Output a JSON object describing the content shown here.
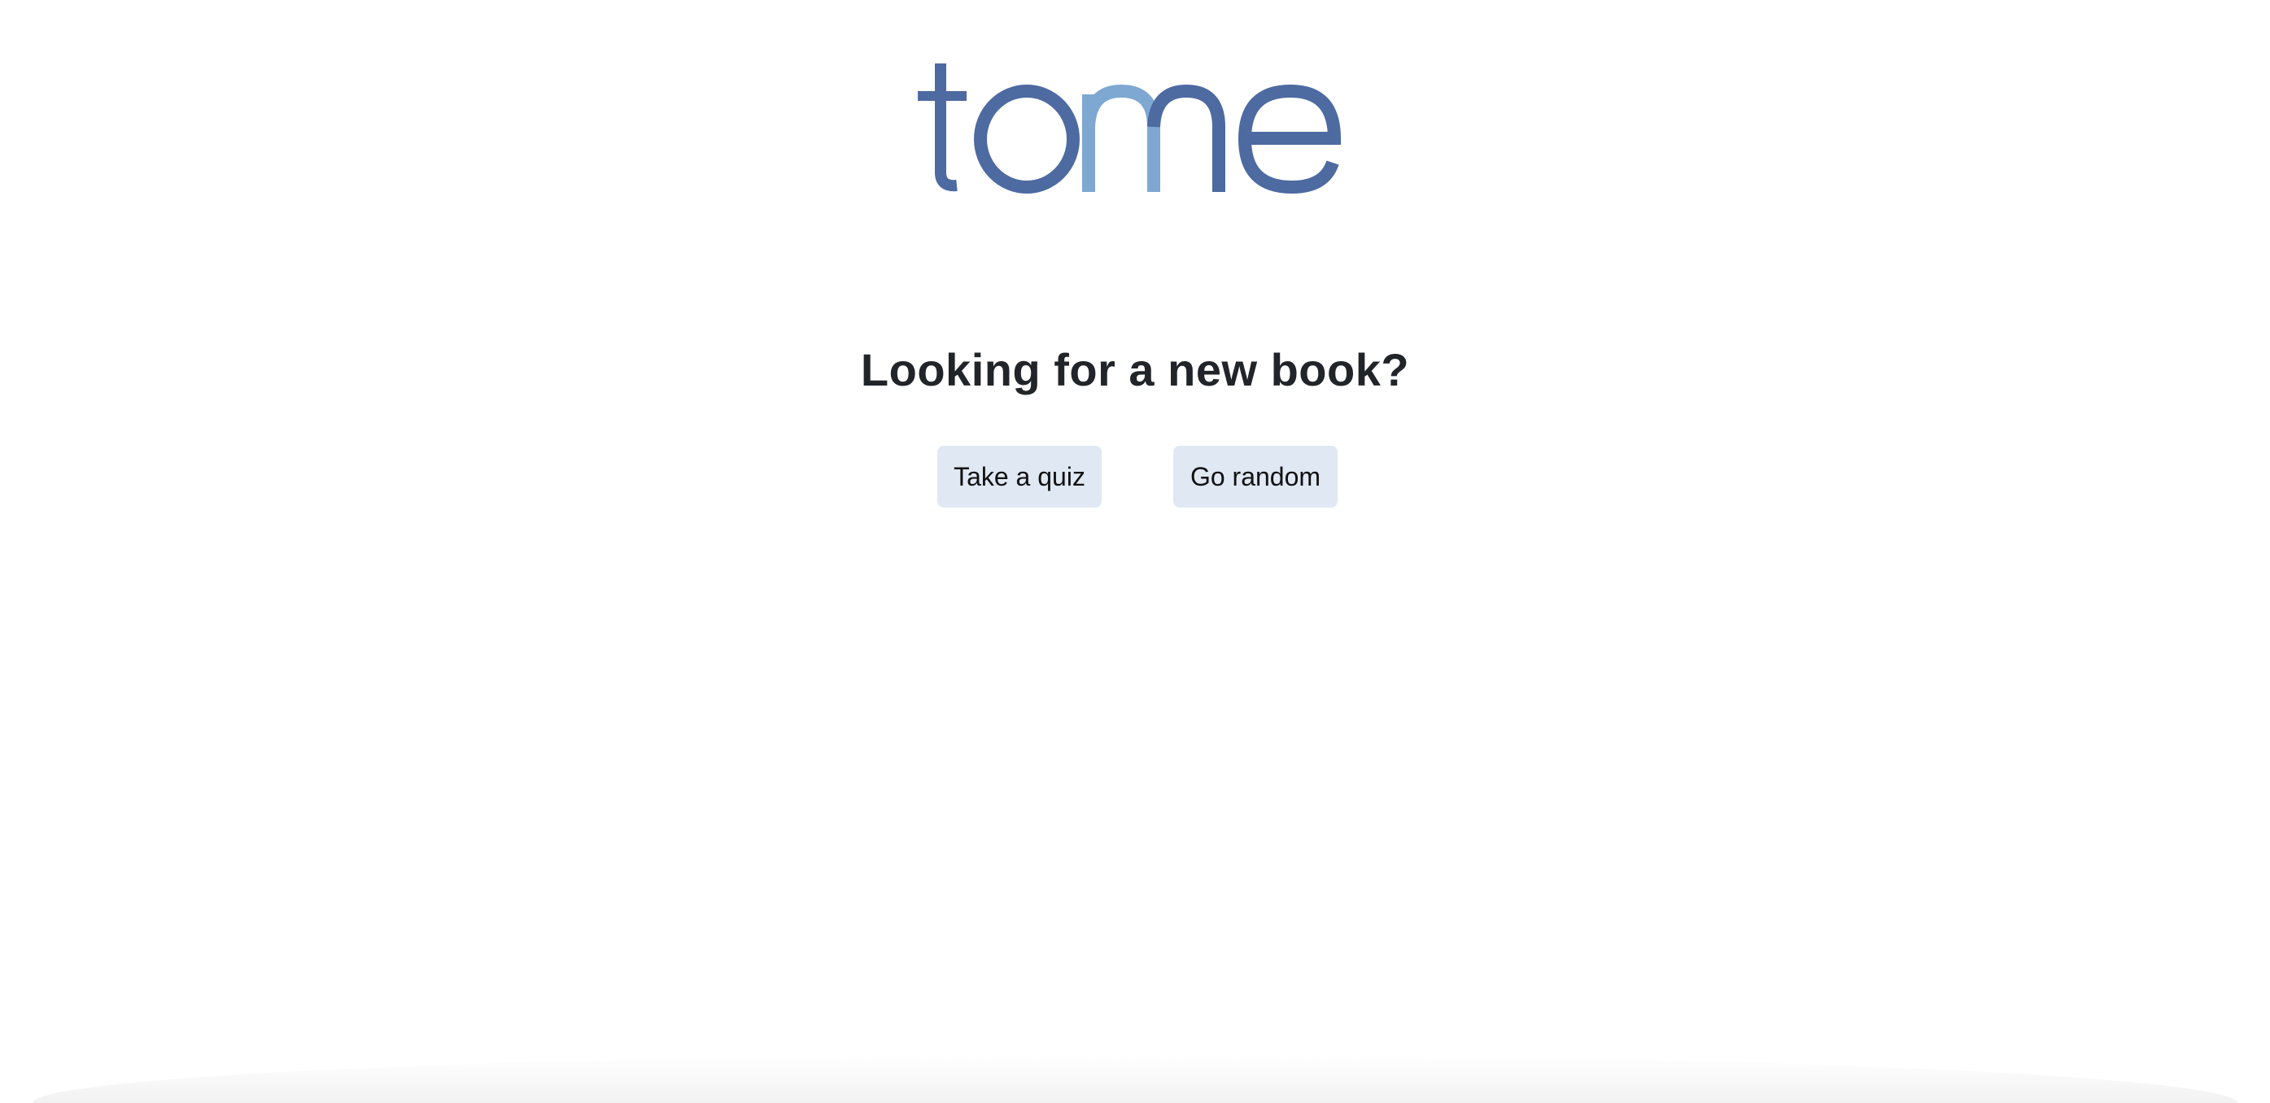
{
  "brand": {
    "logo_text": "tome",
    "letters": [
      "t",
      "o",
      "m",
      "e"
    ],
    "primary_color": "#4d6aa1",
    "accent_color": "#7ea8d1"
  },
  "hero": {
    "headline": "Looking for a new book?"
  },
  "actions": {
    "quiz_label": "Take a quiz",
    "random_label": "Go random",
    "button_bg": "#dfe8f3"
  }
}
